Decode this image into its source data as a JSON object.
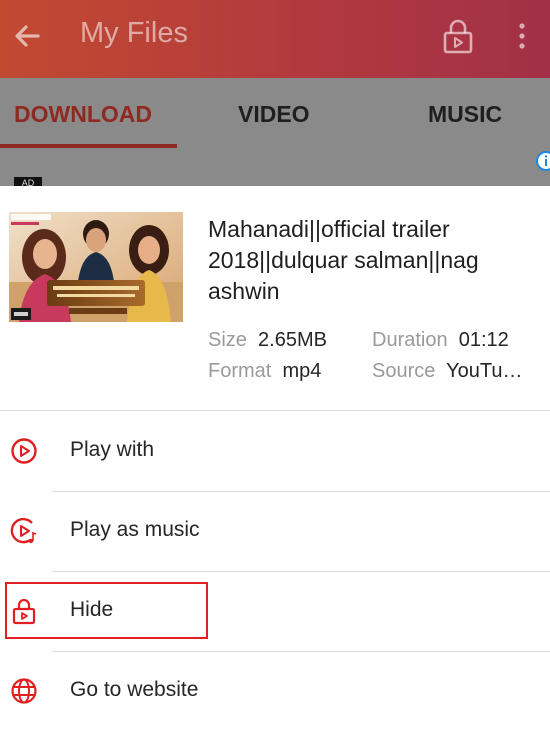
{
  "app_bar": {
    "title": "My Files",
    "back_icon": "arrow-left-icon",
    "lock_icon": "lock-play-icon",
    "more_icon": "more-vert-icon"
  },
  "tabs": [
    {
      "label": "DOWNLOAD",
      "active": true
    },
    {
      "label": "VIDEO",
      "active": false
    },
    {
      "label": "MUSIC",
      "active": false
    }
  ],
  "ad": {
    "tag": "AD"
  },
  "video": {
    "title": "Mahanadi||official trailer 2018||dulquar salman||nag ashwin",
    "size_label": "Size",
    "size_value": "2.65MB",
    "duration_label": "Duration",
    "duration_value": "01:12",
    "format_label": "Format",
    "format_value": "mp4",
    "source_label": "Source",
    "source_value": "YouTu…"
  },
  "menu": [
    {
      "label": "Play with",
      "icon": "play-circle-icon"
    },
    {
      "label": "Play as music",
      "icon": "play-music-icon"
    },
    {
      "label": "Hide",
      "icon": "lock-play-icon"
    },
    {
      "label": "Go to website",
      "icon": "globe-icon"
    }
  ],
  "colors": {
    "accent": "#e02020",
    "appbar_start": "#c14a31",
    "appbar_end": "#a23047",
    "active_tab": "#8e2a22"
  }
}
